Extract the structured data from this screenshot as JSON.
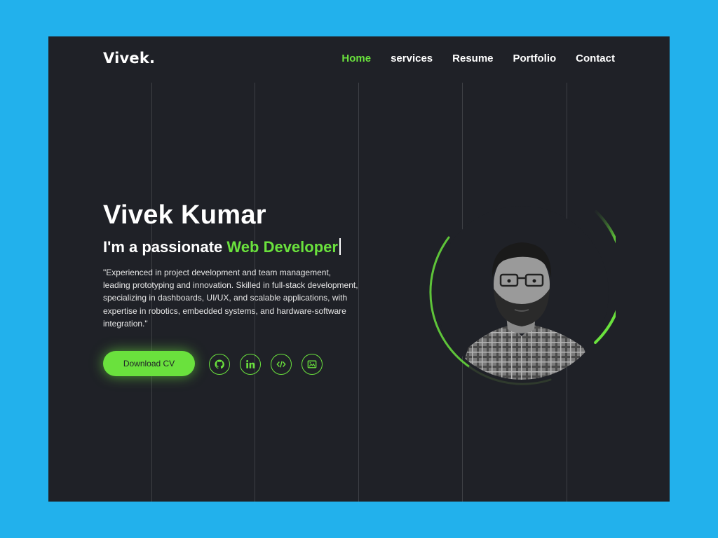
{
  "brand": {
    "logo": "Vivek."
  },
  "nav": {
    "items": [
      {
        "label": "Home",
        "active": true
      },
      {
        "label": "services",
        "active": false
      },
      {
        "label": "Resume",
        "active": false
      },
      {
        "label": "Portfolio",
        "active": false
      },
      {
        "label": "Contact",
        "active": false
      }
    ]
  },
  "hero": {
    "name": "Vivek Kumar",
    "subtitle_prefix": "I'm a passionate ",
    "subtitle_role": "Web Developer",
    "description_lines": [
      "\"Experienced in project development and team management,",
      "leading prototyping and innovation. Skilled in full-stack development,",
      "specializing in dashboards, UI/UX, and scalable applications, with",
      "expertise in robotics, embedded systems, and hardware-software",
      "integration.\""
    ],
    "cta_label": "Download CV"
  },
  "social_links": [
    {
      "icon": "github-icon"
    },
    {
      "icon": "linkedin-icon"
    },
    {
      "icon": "code-icon"
    },
    {
      "icon": "image-icon"
    }
  ],
  "colors": {
    "accent": "#6ae13d",
    "background": "#1f2127",
    "outer": "#22b1ec"
  }
}
